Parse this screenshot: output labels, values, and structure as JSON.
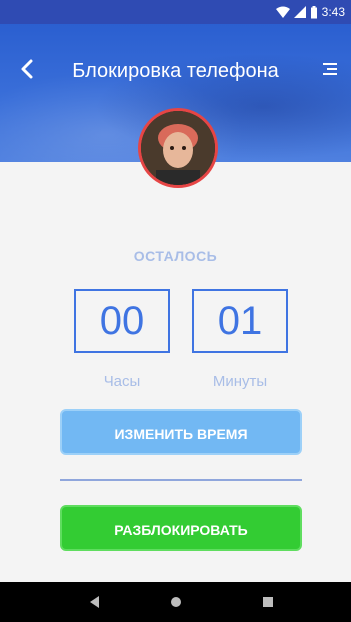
{
  "status_bar": {
    "time": "3:43",
    "icons": [
      "wifi-icon",
      "signal-icon",
      "battery-icon"
    ]
  },
  "header": {
    "title": "Блокировка телефона",
    "back_icon": "back-arrow-icon",
    "menu_icon": "menu-icon"
  },
  "timer": {
    "label": "ОСТАЛОСЬ",
    "hours": "00",
    "minutes": "01",
    "hours_label": "Часы",
    "minutes_label": "Минуты"
  },
  "buttons": {
    "change_time": "ИЗМЕНИТЬ ВРЕМЯ",
    "unlock": "РАЗБЛОКИРОВАТЬ"
  },
  "nav": {
    "icons": [
      "back-triangle-icon",
      "home-circle-icon",
      "recents-square-icon"
    ]
  },
  "colors": {
    "header_blue": "#3a6fd9",
    "accent_blue": "#3f74e2",
    "light_blue": "#72b8f3",
    "green": "#33cc33",
    "muted_label": "#a8bde7"
  }
}
